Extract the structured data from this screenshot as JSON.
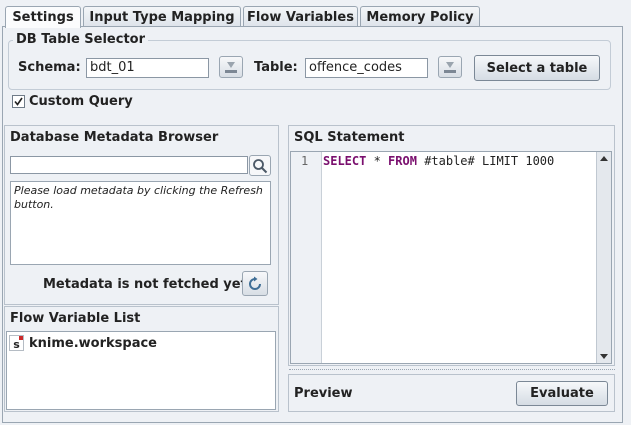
{
  "tabs": [
    {
      "label": "Settings",
      "active": true
    },
    {
      "label": "Input Type Mapping",
      "active": false
    },
    {
      "label": "Flow Variables",
      "active": false
    },
    {
      "label": "Memory Policy",
      "active": false
    }
  ],
  "db_selector": {
    "title": "DB Table Selector",
    "schema_label": "Schema:",
    "schema_value": "bdt_01",
    "table_label": "Table:",
    "table_value": "offence_codes",
    "select_button": "Select a table"
  },
  "custom_query": {
    "label": "Custom Query",
    "checked": true
  },
  "metadata_browser": {
    "title": "Database Metadata Browser",
    "search_value": "",
    "message": "Please load metadata by clicking the Refresh button.",
    "status": "Metadata is not fetched yet."
  },
  "flow_variables": {
    "title": "Flow Variable List",
    "items": [
      {
        "type_glyph": "s",
        "name": "knime.workspace"
      }
    ]
  },
  "sql": {
    "title": "SQL Statement",
    "line_number": "1",
    "tokens": {
      "select": "SELECT",
      "star": " * ",
      "from": "FROM",
      "space": " ",
      "table": "#table#",
      "rest": " LIMIT 1000"
    }
  },
  "preview": {
    "title": "Preview",
    "evaluate_button": "Evaluate"
  },
  "colors": {
    "accent_border": "#9aa6b2",
    "keyword": "#7a0f6e",
    "flow_icon_red": "#cc2a2a"
  },
  "icons": [
    "dropdown-arrow-icon",
    "search-icon",
    "refresh-icon",
    "checkbox-checked-icon",
    "string-variable-icon",
    "scroll-up-icon",
    "scroll-down-icon"
  ]
}
